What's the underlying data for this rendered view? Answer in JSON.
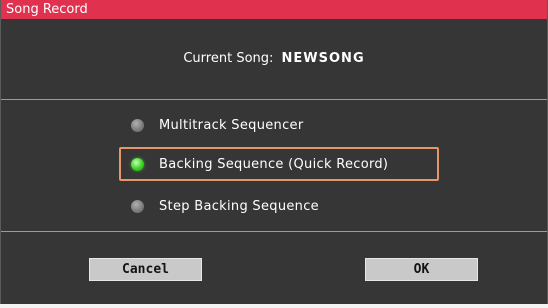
{
  "window": {
    "title": "Song Record"
  },
  "current_song": {
    "label": "Current Song:",
    "name": "NEWSONG"
  },
  "options": [
    {
      "label": "Multitrack Sequencer",
      "selected": false
    },
    {
      "label": "Backing Sequence (Quick Record)",
      "selected": true
    },
    {
      "label": "Step Backing Sequence",
      "selected": false
    }
  ],
  "buttons": {
    "cancel": "Cancel",
    "ok": "OK"
  },
  "colors": {
    "title_bar": "#e0314e",
    "background": "#363636",
    "divider": "#d88a55",
    "selection_outline": "#e8956a",
    "radio_selected": "#42d829"
  }
}
